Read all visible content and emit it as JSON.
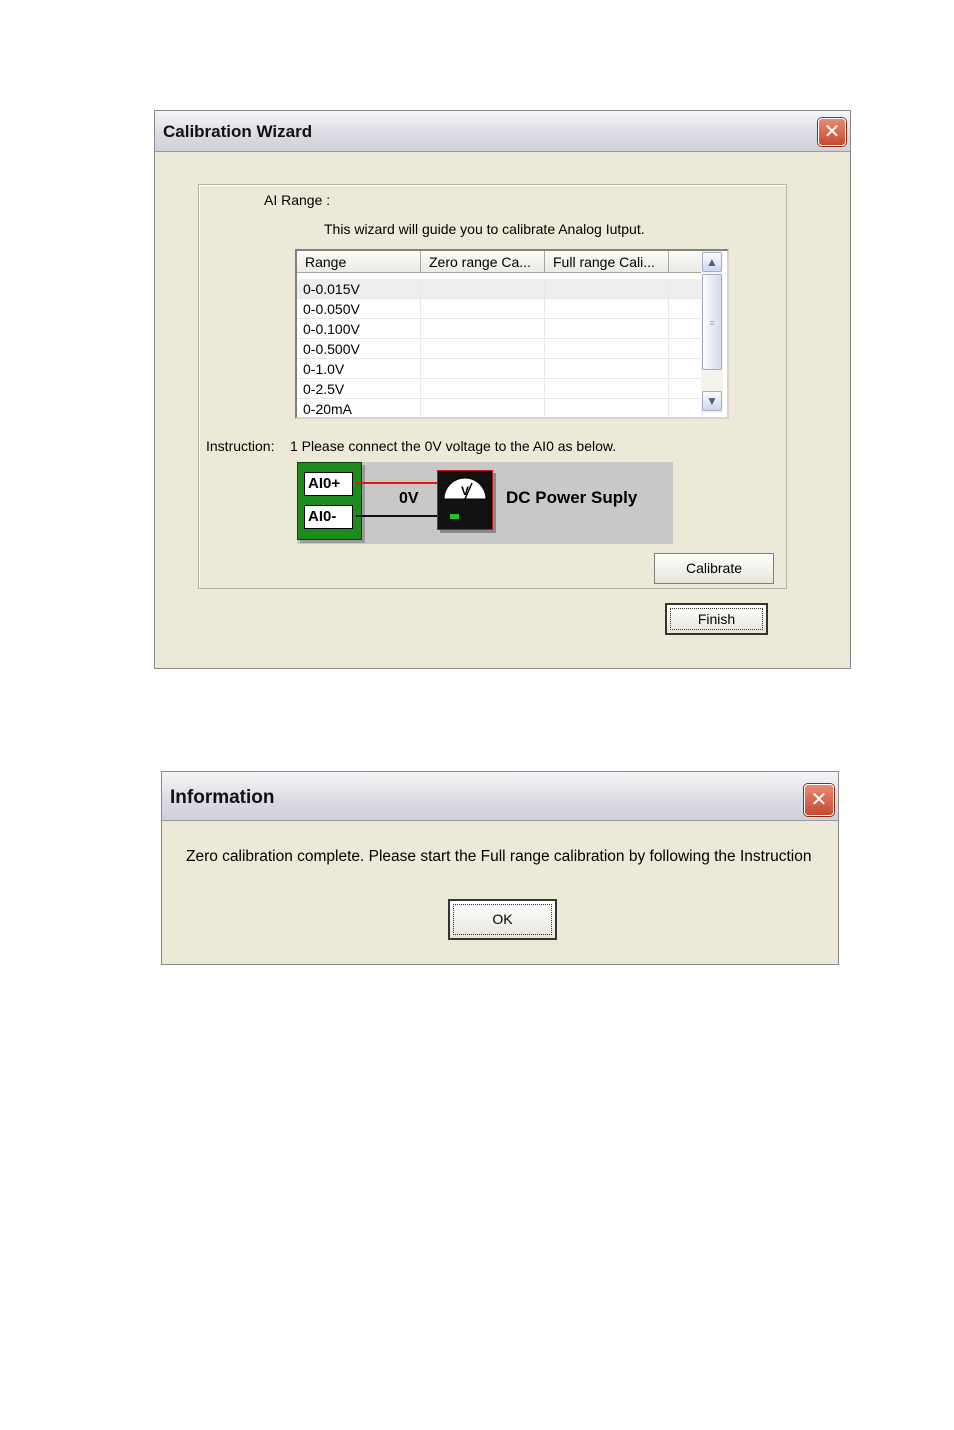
{
  "calibration_wizard": {
    "title": "Calibration Wizard",
    "close_glyph": "✕",
    "ai_range_label": "AI Range :",
    "intro": "This wizard will guide you to calibrate Analog Iutput.",
    "columns": [
      "Range",
      "Zero range Ca...",
      "Full range Cali..."
    ],
    "rows": [
      {
        "range": "0-0.015V",
        "zero": "",
        "full": ""
      },
      {
        "range": "0-0.050V",
        "zero": "",
        "full": ""
      },
      {
        "range": "0-0.100V",
        "zero": "",
        "full": ""
      },
      {
        "range": "0-0.500V",
        "zero": "",
        "full": ""
      },
      {
        "range": "0-1.0V",
        "zero": "",
        "full": ""
      },
      {
        "range": "0-2.5V",
        "zero": "",
        "full": ""
      },
      {
        "range": "0-20mA",
        "zero": "",
        "full": ""
      }
    ],
    "instruction_label": "Instruction:",
    "instruction_text": "1  Please connect the 0V voltage to the AI0 as below.",
    "diagram": {
      "plus_terminal": "AI0+",
      "minus_terminal": "AI0-",
      "voltage": "0V",
      "meter_symbol": "V",
      "device": "DC Power Suply"
    },
    "calibrate_label": "Calibrate",
    "finish_label": "Finish"
  },
  "information": {
    "title": "Information",
    "close_glyph": "✕",
    "message": "Zero calibration complete. Please start the Full range calibration by following the Instruction",
    "ok_label": "OK"
  },
  "colors": {
    "dialog_face": "#ece9d8",
    "terminal_green": "#1e8a1e",
    "wire_red": "#e01818",
    "close_red": "#c44a2e"
  },
  "icons": [
    "close-icon",
    "scroll-up-icon",
    "scroll-down-icon",
    "voltmeter-icon"
  ]
}
